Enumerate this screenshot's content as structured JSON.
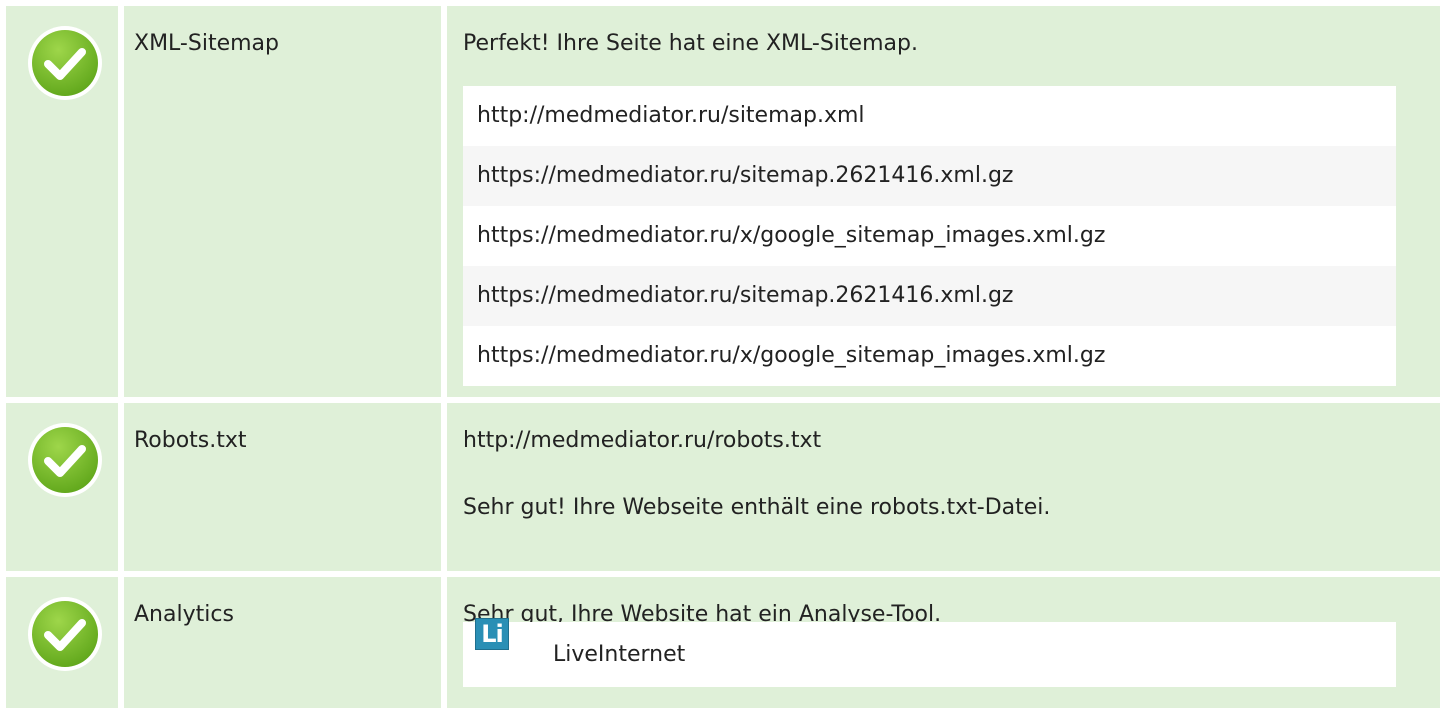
{
  "rows": [
    {
      "status_icon": "check-circle-icon",
      "label": "XML-Sitemap",
      "message": "Perfekt! Ihre Seite hat eine XML-Sitemap.",
      "urls": [
        "http://medmediator.ru/sitemap.xml",
        "https://medmediator.ru/sitemap.2621416.xml.gz",
        "https://medmediator.ru/x/google_sitemap_images.xml.gz",
        "https://medmediator.ru/sitemap.2621416.xml.gz",
        "https://medmediator.ru/x/google_sitemap_images.xml.gz"
      ]
    },
    {
      "status_icon": "check-circle-icon",
      "label": "Robots.txt",
      "url": "http://medmediator.ru/robots.txt",
      "message": "Sehr gut! Ihre Webseite enthält eine robots.txt-Datei."
    },
    {
      "status_icon": "check-circle-icon",
      "label": "Analytics",
      "message": "Sehr gut, Ihre Website hat ein Analyse-Tool.",
      "tools": [
        {
          "logo_text": "Li",
          "name": "LiveInternet"
        }
      ]
    }
  ],
  "colors": {
    "row_background": "#dff0d8",
    "check_green": "#7dbf2a",
    "logo_blue": "#2a8fb5"
  }
}
